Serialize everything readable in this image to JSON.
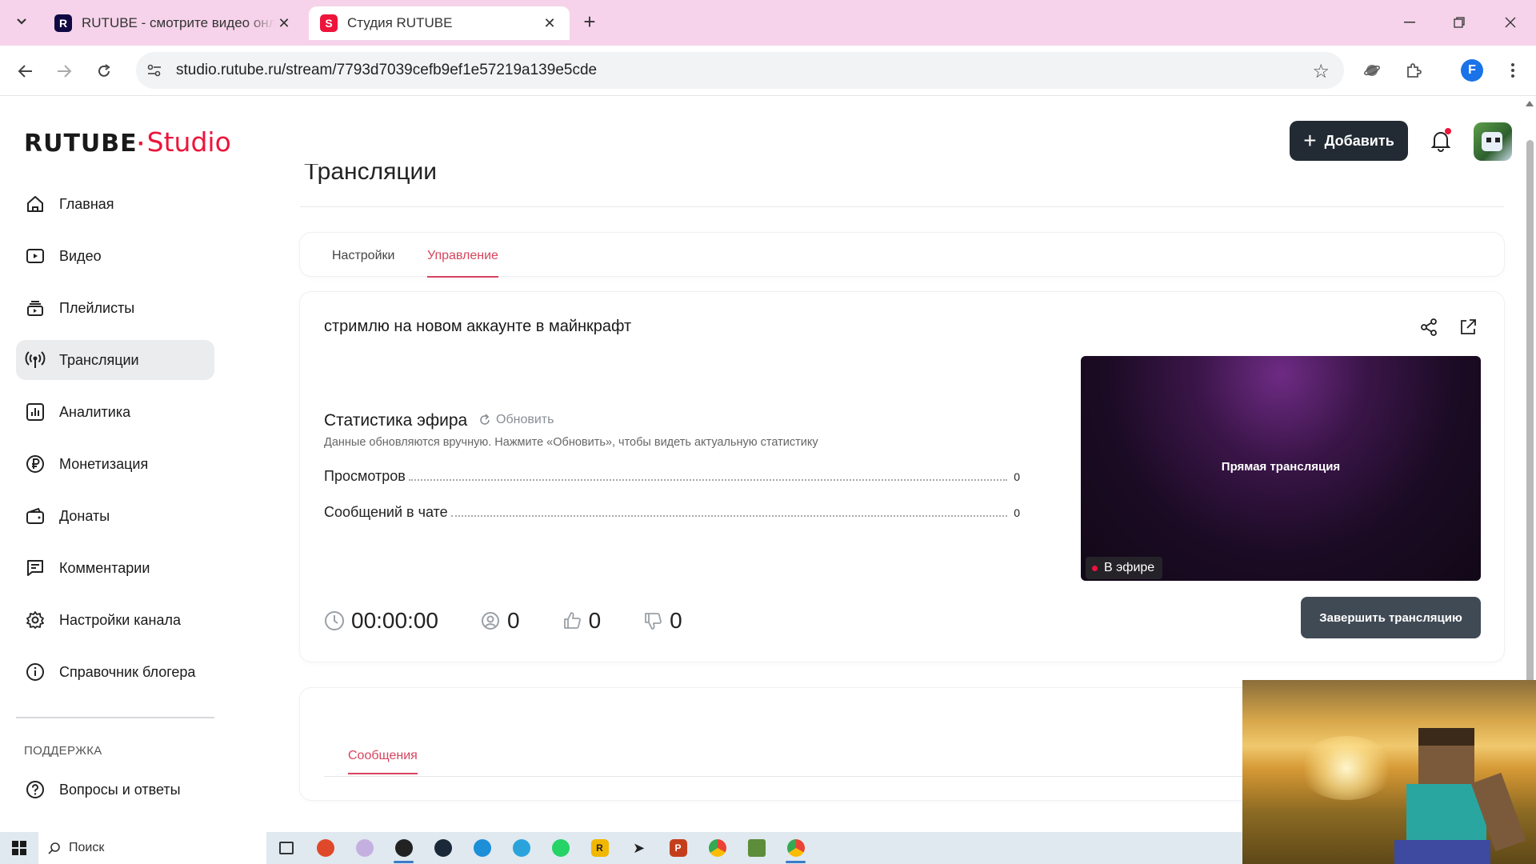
{
  "browser": {
    "tabs": [
      {
        "title": "RUTUBE - смотрите видео онлайн",
        "favicon_letter": "R",
        "favicon_color": "#100943"
      },
      {
        "title": "Студия RUTUBE",
        "favicon_letter": "S",
        "favicon_color": "#ed143b"
      }
    ],
    "url": "studio.rutube.ru/stream/7793d7039cefb9ef1e57219a139e5cde",
    "profile_letter": "F"
  },
  "header": {
    "logo_main": "RUTUBE",
    "logo_sub": "Studio",
    "add_label": "Добавить"
  },
  "sidebar": {
    "items": [
      {
        "label": "Главная",
        "icon": "home-icon"
      },
      {
        "label": "Видео",
        "icon": "video-icon"
      },
      {
        "label": "Плейлисты",
        "icon": "playlist-icon"
      },
      {
        "label": "Трансляции",
        "icon": "broadcast-icon",
        "active": true
      },
      {
        "label": "Аналитика",
        "icon": "analytics-icon"
      },
      {
        "label": "Монетизация",
        "icon": "ruble-icon"
      },
      {
        "label": "Донаты",
        "icon": "wallet-icon"
      },
      {
        "label": "Комментарии",
        "icon": "comment-icon"
      },
      {
        "label": "Настройки канала",
        "icon": "gear-icon"
      },
      {
        "label": "Справочник блогера",
        "icon": "info-icon"
      }
    ],
    "support_label": "ПОДДЕРЖКА",
    "faq_label": "Вопросы и ответы"
  },
  "page": {
    "title": "Трансляции",
    "tabs": [
      {
        "label": "Настройки"
      },
      {
        "label": "Управление",
        "active": true
      }
    ]
  },
  "stream": {
    "title": "стримлю на новом аккаунте в майнкрафт",
    "stats_title": "Статистика эфира",
    "refresh_label": "Обновить",
    "stats_hint": "Данные обновляются вручную. Нажмите «Обновить», чтобы видеть актуальную статистику",
    "rows": [
      {
        "label": "Просмотров",
        "value": "0"
      },
      {
        "label": "Сообщений в чате",
        "value": "0"
      }
    ],
    "duration": "00:00:00",
    "viewers": "0",
    "likes": "0",
    "dislikes": "0",
    "preview_label": "Прямая трансляция",
    "live_badge": "В эфире",
    "end_button": "Завершить трансляцию"
  },
  "messages": {
    "tab_label": "Сообщения"
  },
  "taskbar": {
    "search_placeholder": "Поиск"
  },
  "colors": {
    "accent": "#ed143b",
    "tab_accent": "#d6455e",
    "button_dark": "#222a33",
    "end_button": "#404a55"
  }
}
